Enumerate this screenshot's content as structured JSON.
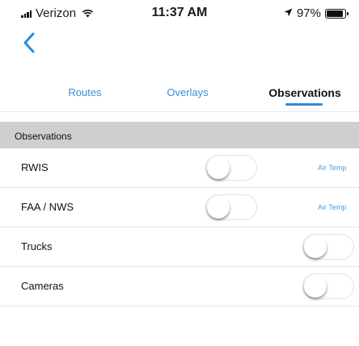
{
  "status_bar": {
    "carrier": "Verizon",
    "time": "11:37 AM",
    "battery": "97%",
    "battery_level": 0.97,
    "icons": [
      "signal-icon",
      "wifi-icon",
      "location-arrow-icon",
      "battery-icon"
    ]
  },
  "nav": {
    "back_icon": "chevron-left-icon"
  },
  "tabs": [
    {
      "label": "Routes",
      "active": false
    },
    {
      "label": "Overlays",
      "active": false
    },
    {
      "label": "Observations",
      "active": true
    }
  ],
  "section": {
    "title": "Observations"
  },
  "rows": [
    {
      "label": "RWIS",
      "toggle_on": false,
      "link": "Air Temp"
    },
    {
      "label": "FAA / NWS",
      "toggle_on": false,
      "link": "Air Temp"
    },
    {
      "label": "Trucks",
      "toggle_on": false
    },
    {
      "label": "Cameras",
      "toggle_on": false
    }
  ],
  "colors": {
    "accent": "#3a8fd6",
    "section_bg": "#cfcfcf",
    "link": "#4a9ee0"
  }
}
